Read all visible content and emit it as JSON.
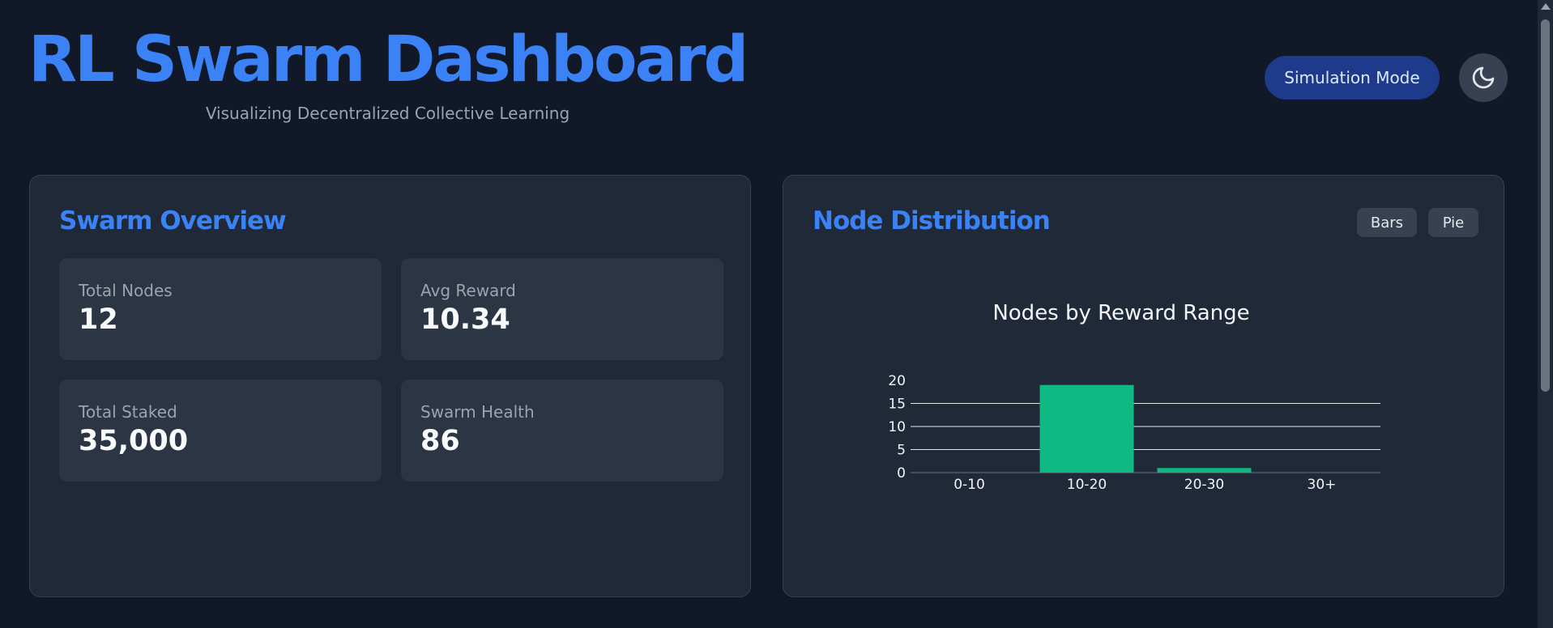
{
  "header": {
    "title": "RL Swarm Dashboard",
    "subtitle": "Visualizing Decentralized Collective Learning",
    "mode_button": "Simulation Mode",
    "theme_icon": "moon-icon"
  },
  "overview": {
    "title": "Swarm Overview",
    "stats": [
      {
        "label": "Total Nodes",
        "value": "12"
      },
      {
        "label": "Avg Reward",
        "value": "10.34"
      },
      {
        "label": "Total Staked",
        "value": "35,000"
      },
      {
        "label": "Swarm Health",
        "value": "86"
      }
    ]
  },
  "distribution": {
    "title": "Node Distribution",
    "toggles": [
      "Bars",
      "Pie"
    ]
  },
  "chart_data": {
    "type": "bar",
    "title": "Nodes by Reward Range",
    "categories": [
      "0-10",
      "10-20",
      "20-30",
      "30+"
    ],
    "values": [
      0,
      19,
      1,
      0
    ],
    "ylim": [
      0,
      20
    ],
    "yticks": [
      0,
      5,
      10,
      15,
      20
    ],
    "xlabel": "",
    "ylabel": "",
    "grid": true,
    "bar_color": "#10b981"
  },
  "colors": {
    "accent": "#3b82f6",
    "background": "#111827",
    "card": "#1f2937",
    "bar": "#10b981"
  }
}
